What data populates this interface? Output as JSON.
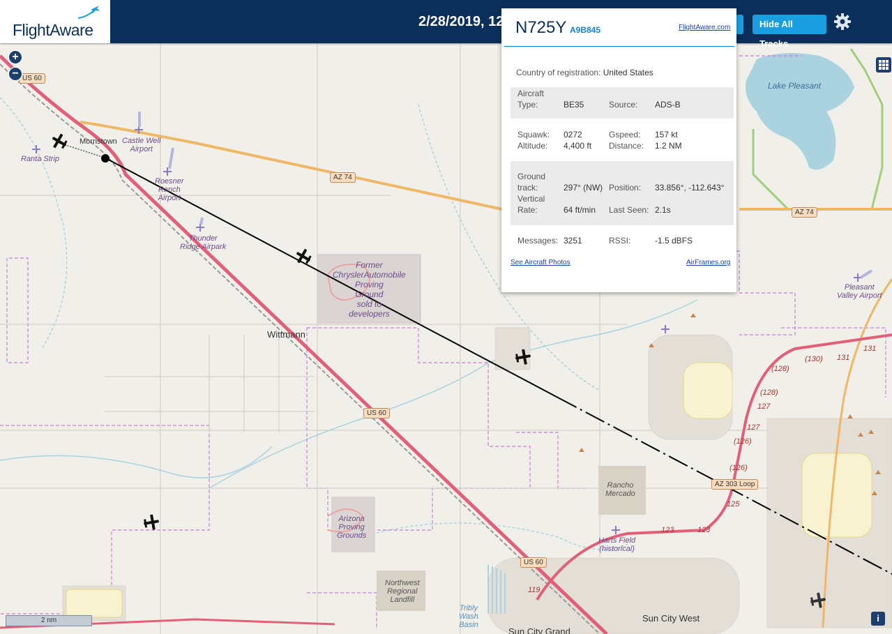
{
  "header": {
    "logo": "FlightAware",
    "date": "2/28/2019, 12",
    "hide_tracks_label": "Hide All Tracks"
  },
  "popup": {
    "ident": "N725Y",
    "hex": "A9B845",
    "flightaware_link": "FlightAware.com",
    "country_label": "Country of registration:",
    "country_value": "United States",
    "rows": {
      "aircraft_type_label": "Aircraft Type:",
      "aircraft_type_value": "BE35",
      "source_label": "Source:",
      "source_value": "ADS-B",
      "squawk_label": "Squawk:",
      "squawk_value": "0272",
      "altitude_label": "Altitude:",
      "altitude_value": "4,400 ft",
      "gspeed_label": "Gspeed:",
      "gspeed_value": "157 kt",
      "distance_label": "Distance:",
      "distance_value": "1.2 NM",
      "ground_track_label": "Ground track:",
      "ground_track_value": "297° (NW)",
      "position_label": "Position:",
      "position_value": "33.856°, -112.643°",
      "vertical_rate_label": "Vertical Rate:",
      "vertical_rate_value": "64 ft/min",
      "last_seen_label": "Last Seen:",
      "last_seen_value": "2.1s",
      "messages_label": "Messages:",
      "messages_value": "3251",
      "rssi_label": "RSSI:",
      "rssi_value": "-1.5 dBFS"
    },
    "photos_link": "See Aircraft Photos",
    "airframes_link": "AirFrames.org"
  },
  "map": {
    "zoom_in": "+",
    "zoom_out": "−",
    "scale_label": "2 nm",
    "info_label": "i",
    "towns": {
      "morristown": "Morristown",
      "wittmann": "Wittmann",
      "sun_city_west": "Sun City West",
      "sun_city_grand": "Sun City Grand"
    },
    "shields": {
      "us60_a": "US 60",
      "us60_b": "US 60",
      "us60_c": "US 60",
      "az74_a": "AZ 74",
      "az74_b": "AZ 74",
      "az303": "AZ 303 Loop"
    },
    "labels": {
      "ranta": "Ranta Strip",
      "castle_well": "Castle Well\nAirport",
      "roesner": "Roesner\nRanch\nAirport",
      "thunder_ridge": "Thunder\nRidge Airpark",
      "chrysler": "Former\nChryslerAutomobile\nProving\nGround\nsold to\ndevelopers",
      "arizona_proving": "Arizona\nProving\nGrounds",
      "rancho_mercado": "Rancho\nMercado",
      "harts_field": "Harts Field\n(historical)",
      "northwest_landfill": "Northwest\nRegional\nLandfill",
      "tribly": "Tribly\nWash\nBasin",
      "lake_pleasant": "Lake Pleasant",
      "pleasant_valley": "Pleasant\nValley Airport"
    },
    "road_numbers": {
      "r119": "119",
      "r123a": "123",
      "r123b": "123",
      "r125": "125",
      "r126a": "(126)",
      "r126b": "(126)",
      "r127a": "127",
      "r127b": "127",
      "r128a": "(128)",
      "r128b": "(128)",
      "r130": "(130)",
      "r131a": "131",
      "r131b": "131"
    }
  },
  "colors": {
    "header_bg": "#0b2f5b",
    "button_blue": "#1a9ee0",
    "highway_orange": "#f0b767",
    "freeway_red": "#e0607a",
    "water_blue": "#aad3df",
    "boundary_purple": "#c77fd4",
    "park_green": "#cfe8a8"
  }
}
